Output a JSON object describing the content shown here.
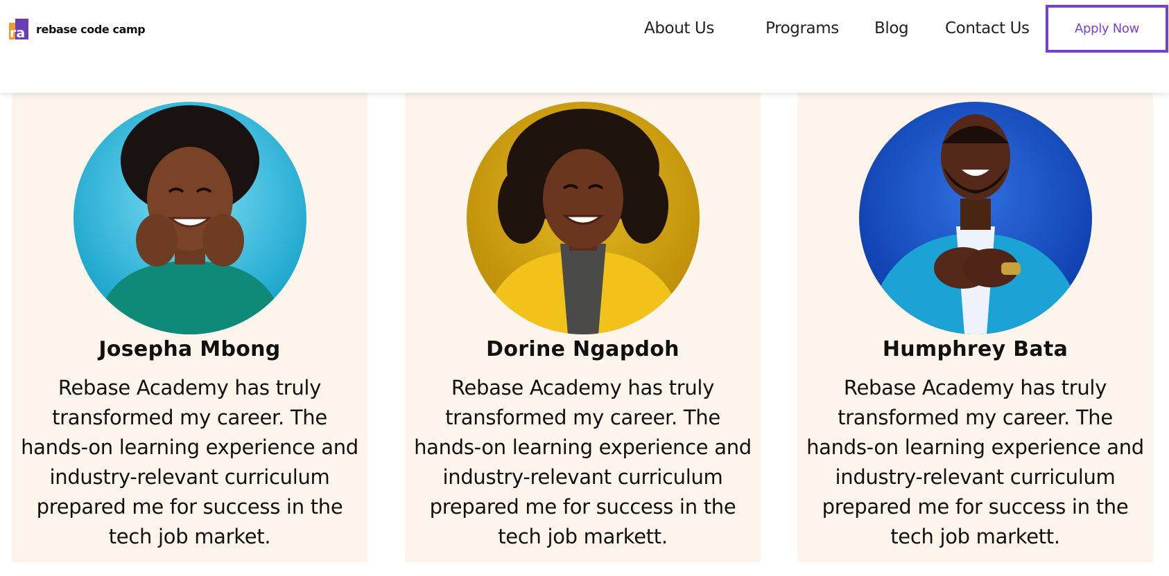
{
  "header": {
    "brand": "rebase code camp",
    "logo_icon": "ra-logo-icon",
    "nav": [
      "About Us",
      "Programs",
      "Blog",
      "Contact Us"
    ],
    "cta": "Apply Now",
    "accent_color": "#7b3fd0"
  },
  "testimonials": [
    {
      "name": "Josepha Mbong",
      "quote": "Rebase Academy has truly transformed my career. The hands-on learning experience and industry-relevant curriculum prepared me for success in the tech job market.",
      "photo_background": "#22b6de"
    },
    {
      "name": "Dorine Ngapdoh",
      "quote": "Rebase Academy has truly transformed my career. The hands-on learning experience and industry-relevant curriculum prepared me for success in the tech job markett.",
      "photo_background": "#d5a40c"
    },
    {
      "name": "Humphrey Bata",
      "quote": "Rebase Academy has truly transformed my career. The hands-on learning experience and industry-relevant curriculum prepared me for success in the tech job markett.",
      "photo_background": "#1450c8"
    }
  ]
}
